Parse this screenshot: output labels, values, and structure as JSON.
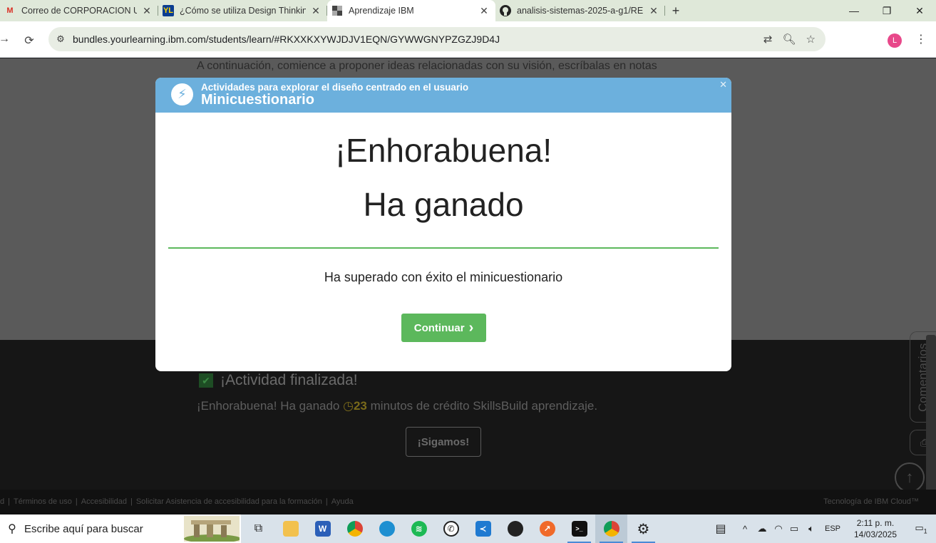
{
  "browser": {
    "tabs": [
      {
        "title": "Correo de CORPORACION UNIV",
        "icon": "gmail-icon",
        "active": false
      },
      {
        "title": "¿Cómo se utiliza Design Thinkin",
        "icon": "yl-icon",
        "active": false
      },
      {
        "title": "Aprendizaje IBM",
        "icon": "ibm-icon",
        "active": true
      },
      {
        "title": "analisis-sistemas-2025-a-g1/RE",
        "icon": "github-icon",
        "active": false
      }
    ],
    "url": "bundles.yourlearning.ibm.com/students/learn/#RKXXKXYWJDJV1EQN/GYWWGNYPZGZJ9D4J",
    "profile_initial": "L"
  },
  "page": {
    "intro": "A continuación, comience a proponer ideas relacionadas con su visión, escríbalas en notas",
    "activity_done": "¡Actividad finalizada!",
    "credit_prefix": "¡Enhorabuena! Ha ganado",
    "credit_minutes": "23",
    "credit_suffix": "minutos de crédito SkillsBuild aprendizaje.",
    "continue_button": "¡Sigamos!",
    "comments_tab": "Comentarios",
    "footer_links": [
      "d",
      "Términos de uso",
      "Accesibilidad",
      "Solicitar Asistencia de accesibilidad para la formación",
      "Ayuda"
    ],
    "footer_brand": "Tecnología de IBM Cloud™"
  },
  "modal": {
    "subtitle": "Actividades para explorar el diseño centrado en el usuario",
    "title": "Minicuestionario",
    "heading1": "¡Enhorabuena!",
    "heading2": "Ha ganado",
    "message": "Ha superado con éxito el minicuestionario",
    "button": "Continuar",
    "accent_color": "#5cb85c",
    "header_color": "#6cb0dd"
  },
  "taskbar": {
    "search_placeholder": "Escribe aquí para buscar",
    "language": "ESP",
    "time": "2:11 p. m.",
    "date": "14/03/2025",
    "notification_count": "1"
  }
}
